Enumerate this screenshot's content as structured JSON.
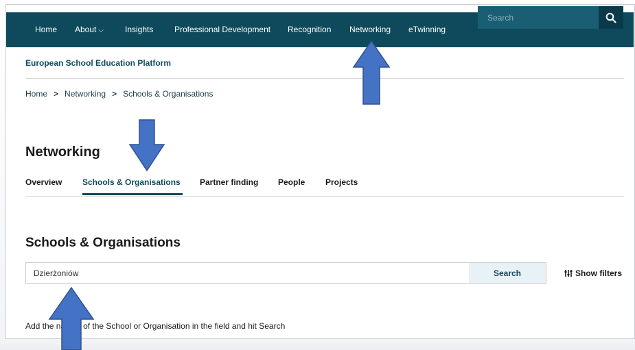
{
  "nav": {
    "items": [
      {
        "label": "Home"
      },
      {
        "label": "About"
      },
      {
        "label": "Insights"
      },
      {
        "label": "Professional Development"
      },
      {
        "label": "Recognition"
      },
      {
        "label": "Networking"
      },
      {
        "label": "eTwinning"
      }
    ],
    "search_placeholder": "Search"
  },
  "platform_name": "European School Education Platform",
  "breadcrumb": [
    "Home",
    "Networking",
    "Schools & Organisations"
  ],
  "page_title": "Networking",
  "tabs": [
    {
      "label": "Overview"
    },
    {
      "label": "Schools & Organisations",
      "active": true
    },
    {
      "label": "Partner finding"
    },
    {
      "label": "People"
    },
    {
      "label": "Projects"
    }
  ],
  "section_title": "Schools & Organisations",
  "search": {
    "value": "Dzierżoniów",
    "button_label": "Search"
  },
  "show_filters_label": "Show filters",
  "hint": {
    "before": "Add the na",
    "after": "of the School or Organisation in the field and hit Search"
  },
  "colors": {
    "nav_bg": "#0e4a5c",
    "accent": "#0e4a5c",
    "arrow_fill": "#4472c4",
    "arrow_stroke": "#2f528f"
  }
}
